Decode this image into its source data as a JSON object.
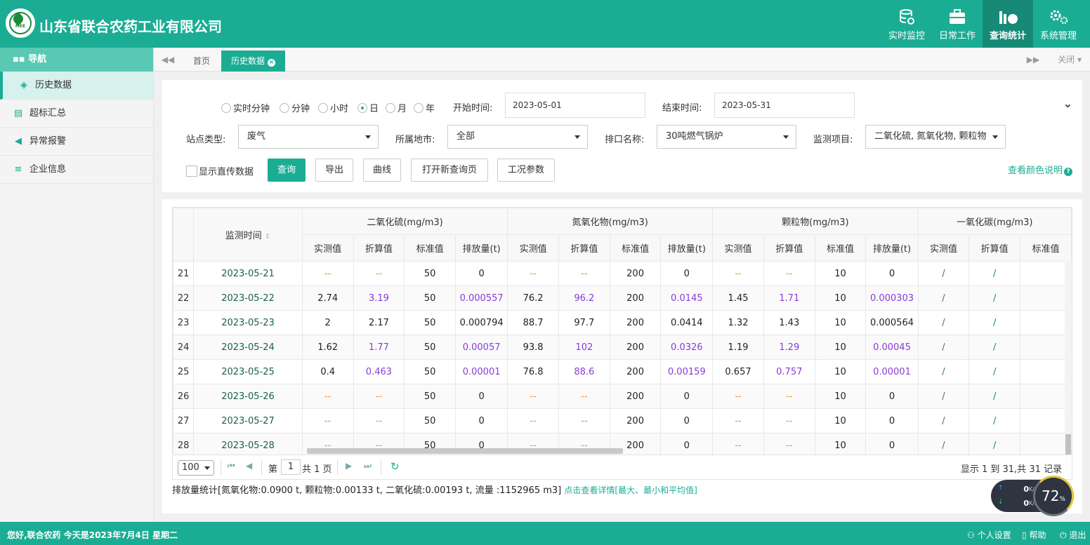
{
  "header": {
    "logo_text": "MEE",
    "company": "山东省联合农药工业有限公司",
    "nav": [
      {
        "label": "实时监控",
        "icon": "database-icon"
      },
      {
        "label": "日常工作",
        "icon": "briefcase-icon"
      },
      {
        "label": "查询统计",
        "icon": "chart-icon",
        "active": true
      },
      {
        "label": "系统管理",
        "icon": "gears-icon"
      }
    ]
  },
  "sidebar": {
    "title": "导航",
    "items": [
      {
        "label": "历史数据",
        "icon": "layers-icon",
        "active": true
      },
      {
        "label": "超标汇总",
        "icon": "clipboard-icon"
      },
      {
        "label": "异常报警",
        "icon": "speaker-icon"
      },
      {
        "label": "企业信息",
        "icon": "list-icon"
      }
    ]
  },
  "tabs": {
    "items": [
      "首页",
      "历史数据"
    ],
    "active": "历史数据",
    "close_menu": "关闭"
  },
  "filters": {
    "granularity": [
      "实时分钟",
      "分钟",
      "小时",
      "日",
      "月",
      "年"
    ],
    "granularity_selected": "日",
    "start_label": "开始时间:",
    "start_value": "2023-05-01",
    "end_label": "结束时间:",
    "end_value": "2023-05-31",
    "site_type_label": "站点类型:",
    "site_type_value": "废气",
    "region_label": "所属地市:",
    "region_value": "全部",
    "outlet_label": "排口名称:",
    "outlet_value": "30吨燃气锅炉",
    "item_label": "监测项目:",
    "item_value": "二氧化硫, 氮氧化物, 颗粒物",
    "show_direct_label": "显示直传数据",
    "buttons": {
      "query": "查询",
      "export": "导出",
      "curve": "曲线",
      "new_page": "打开新查询页",
      "condition": "工况参数"
    },
    "color_help": "查看颜色说明"
  },
  "table": {
    "time_header": "监测时间",
    "groups": [
      "二氧化硫(mg/m3)",
      "氮氧化物(mg/m3)",
      "颗粒物(mg/m3)",
      "一氧化碳(mg/m3)"
    ],
    "subcols": [
      "实测值",
      "折算值",
      "标准值",
      "排放量(t)"
    ],
    "rows": [
      {
        "idx": "21",
        "date": "2023-05-21",
        "cells": [
          "--",
          "--",
          "50",
          "0",
          "--",
          "--",
          "200",
          "0",
          "--",
          "--",
          "10",
          "0",
          "/",
          "/",
          ""
        ]
      },
      {
        "idx": "22",
        "date": "2023-05-22",
        "cells": [
          "2.74",
          "3.19",
          "50",
          "0.000557",
          "76.2",
          "96.2",
          "200",
          "0.0145",
          "1.45",
          "1.71",
          "10",
          "0.000303",
          "/",
          "/",
          ""
        ]
      },
      {
        "idx": "23",
        "date": "2023-05-23",
        "cells": [
          "2",
          "2.17",
          "50",
          "0.000794",
          "88.7",
          "97.7",
          "200",
          "0.0414",
          "1.32",
          "1.43",
          "10",
          "0.000564",
          "/",
          "/",
          ""
        ]
      },
      {
        "idx": "24",
        "date": "2023-05-24",
        "cells": [
          "1.62",
          "1.77",
          "50",
          "0.00057",
          "93.8",
          "102",
          "200",
          "0.0326",
          "1.19",
          "1.29",
          "10",
          "0.00045",
          "/",
          "/",
          ""
        ]
      },
      {
        "idx": "25",
        "date": "2023-05-25",
        "cells": [
          "0.4",
          "0.463",
          "50",
          "0.00001",
          "76.8",
          "88.6",
          "200",
          "0.00159",
          "0.657",
          "0.757",
          "10",
          "0.00001",
          "/",
          "/",
          ""
        ]
      },
      {
        "idx": "26",
        "date": "2023-05-26",
        "cells": [
          "--",
          "--",
          "50",
          "0",
          "--",
          "--",
          "200",
          "0",
          "--",
          "--",
          "10",
          "0",
          "/",
          "/",
          ""
        ]
      },
      {
        "idx": "27",
        "date": "2023-05-27",
        "cells": [
          "--",
          "--",
          "50",
          "0",
          "--",
          "--",
          "200",
          "0",
          "--",
          "--",
          "10",
          "0",
          "/",
          "/",
          ""
        ]
      },
      {
        "idx": "28",
        "date": "2023-05-28",
        "cells": [
          "--",
          "--",
          "50",
          "0",
          "--",
          "--",
          "200",
          "0",
          "--",
          "--",
          "10",
          "0",
          "/",
          "/",
          ""
        ]
      }
    ],
    "purple_rows": [
      "22",
      "24",
      "25"
    ],
    "colors": {
      "dash": "#e8901a",
      "purple": "#8a3ad8",
      "slash": "#2b8a3e"
    }
  },
  "pager": {
    "page_size": "100",
    "page_prefix": "第",
    "page_value": "1",
    "page_total": "共 1 页",
    "summary": "显示 1 到 31,共 31 记录"
  },
  "stats": {
    "text": "排放量统计[氮氧化物:0.0900 t, 颗粒物:0.00133 t, 二氧化硫:0.00193 t, 流量 :1152965 m3]",
    "detail_link": "点击查看详情[最大、最小和平均值]"
  },
  "net": {
    "up": "0",
    "down": "0",
    "unit": "K/s",
    "percent": "72",
    "pct_sign": "%"
  },
  "footer": {
    "greeting": "您好,联合农药 今天是2023年7月4日 星期二",
    "personal": "个人设置",
    "help": "帮助",
    "logout": "退出"
  },
  "colors": {
    "brand": "#1aad94"
  }
}
